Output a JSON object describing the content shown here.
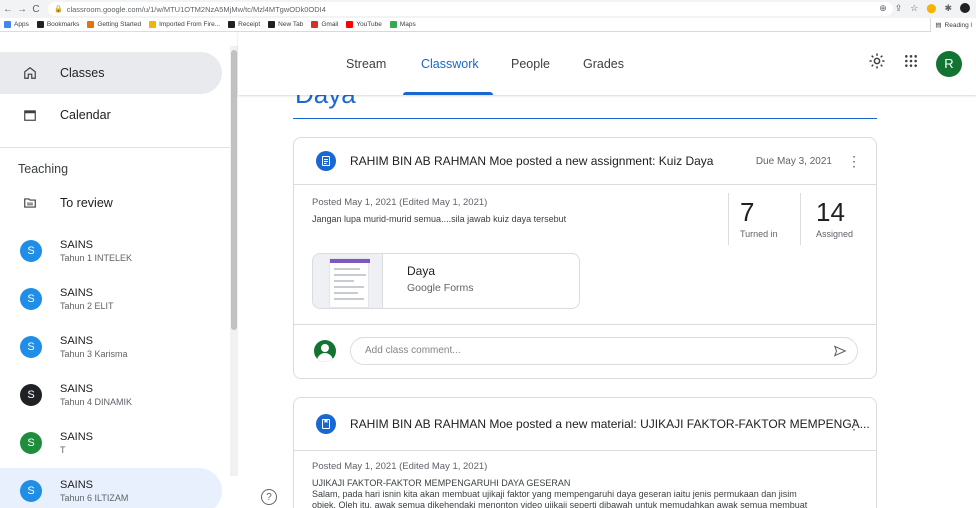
{
  "browser": {
    "url": "classroom.google.com/u/1/w/MTU1OTM2NzA5MjMw/tc/Mzl4MTgwODk0ODI4",
    "bookmarks": [
      {
        "label": "Apps",
        "icon": "apps-grid-icon",
        "color": "#4285f4"
      },
      {
        "label": "Bookmarks",
        "icon": "star-icon",
        "color": "#202124"
      },
      {
        "label": "Getting Started",
        "icon": "firefox-icon",
        "color": "#e8710a"
      },
      {
        "label": "Imported From Fire...",
        "icon": "folder-icon",
        "color": "#f4b400"
      },
      {
        "label": "Receipt",
        "icon": "globe-icon",
        "color": "#202124"
      },
      {
        "label": "New Tab",
        "icon": "globe-icon",
        "color": "#202124"
      },
      {
        "label": "Gmail",
        "icon": "gmail-icon",
        "color": "#d93025"
      },
      {
        "label": "YouTube",
        "icon": "youtube-icon",
        "color": "#ff0000"
      },
      {
        "label": "Maps",
        "icon": "maps-pin-icon",
        "color": "#34a853"
      }
    ],
    "reading_list": "Reading l"
  },
  "sidebar": {
    "nav": [
      {
        "label": "Classes",
        "icon": "home-icon",
        "active": true
      },
      {
        "label": "Calendar",
        "icon": "calendar-icon",
        "active": false
      }
    ],
    "teaching_heading": "Teaching",
    "to_review": "To review",
    "classes": [
      {
        "initial": "S",
        "name": "SAINS",
        "section": "Tahun 1 INTELEK",
        "color": "#1e8ee6"
      },
      {
        "initial": "S",
        "name": "SAINS",
        "section": "Tahun 2 ELIT",
        "color": "#1e8ee6"
      },
      {
        "initial": "S",
        "name": "SAINS",
        "section": "Tahun 3 Karisma",
        "color": "#1e8ee6"
      },
      {
        "initial": "S",
        "name": "SAINS",
        "section": "Tahun 4 DINAMIK",
        "color": "#202124"
      },
      {
        "initial": "S",
        "name": "SAINS",
        "section": "T",
        "color": "#1e8e3e"
      },
      {
        "initial": "S",
        "name": "SAINS",
        "section": "Tahun 6 ILTIZAM",
        "color": "#1e8ee6"
      }
    ]
  },
  "topnav": {
    "tabs": [
      {
        "label": "Stream"
      },
      {
        "label": "Classwork"
      },
      {
        "label": "People"
      },
      {
        "label": "Grades"
      }
    ],
    "active_tab": "Classwork",
    "user_initial": "R"
  },
  "main": {
    "topic_title": "Daya",
    "assignment": {
      "title": "RAHIM BIN AB RAHMAN Moe posted a new assignment: Kuiz Daya",
      "due": "Due May 3, 2021",
      "posted": "Posted May 1, 2021 (Edited May 1, 2021)",
      "description": "Jangan lupa murid-murid semua....sila jawab kuiz daya tersebut",
      "turned_in_count": "7",
      "turned_in_label": "Turned in",
      "assigned_count": "14",
      "assigned_label": "Assigned",
      "attachment_title": "Daya",
      "attachment_type": "Google Forms",
      "comment_placeholder": "Add class comment..."
    },
    "material": {
      "title": "RAHIM BIN AB RAHMAN Moe posted a new material: UJIKAJI FAKTOR-FAKTOR MEMPENGA...",
      "posted": "Posted May 1, 2021 (Edited May 1, 2021)",
      "line1": "UJIKAJI FAKTOR-FAKTOR MEMPENGARUHI DAYA GESERAN",
      "line2": "Salam, pada hari isnin kita akan membuat ujikaji faktor yang mempengaruhi daya geseran iaitu jenis permukaan dan jisim",
      "line3": "objek. Oleh itu, awak semua dikehendaki menonton video ujikaji seperti dibawah untuk memudahkan awak semua membuat"
    }
  },
  "colors": {
    "accent": "#1967d2",
    "avatar_green": "#137333"
  }
}
